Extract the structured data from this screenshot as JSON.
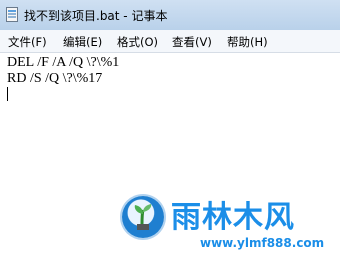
{
  "window": {
    "title": "找不到该项目.bat - 记事本"
  },
  "menu": {
    "items": [
      "文件(F)",
      "编辑(E)",
      "格式(O)",
      "查看(V)",
      "帮助(H)"
    ]
  },
  "editor": {
    "lines": [
      "DEL /F /A /Q \\?\\%1",
      "RD /S /Q \\?\\%17"
    ]
  },
  "watermark": {
    "brand": "雨林木风",
    "url": "www.ylmf888.com"
  }
}
